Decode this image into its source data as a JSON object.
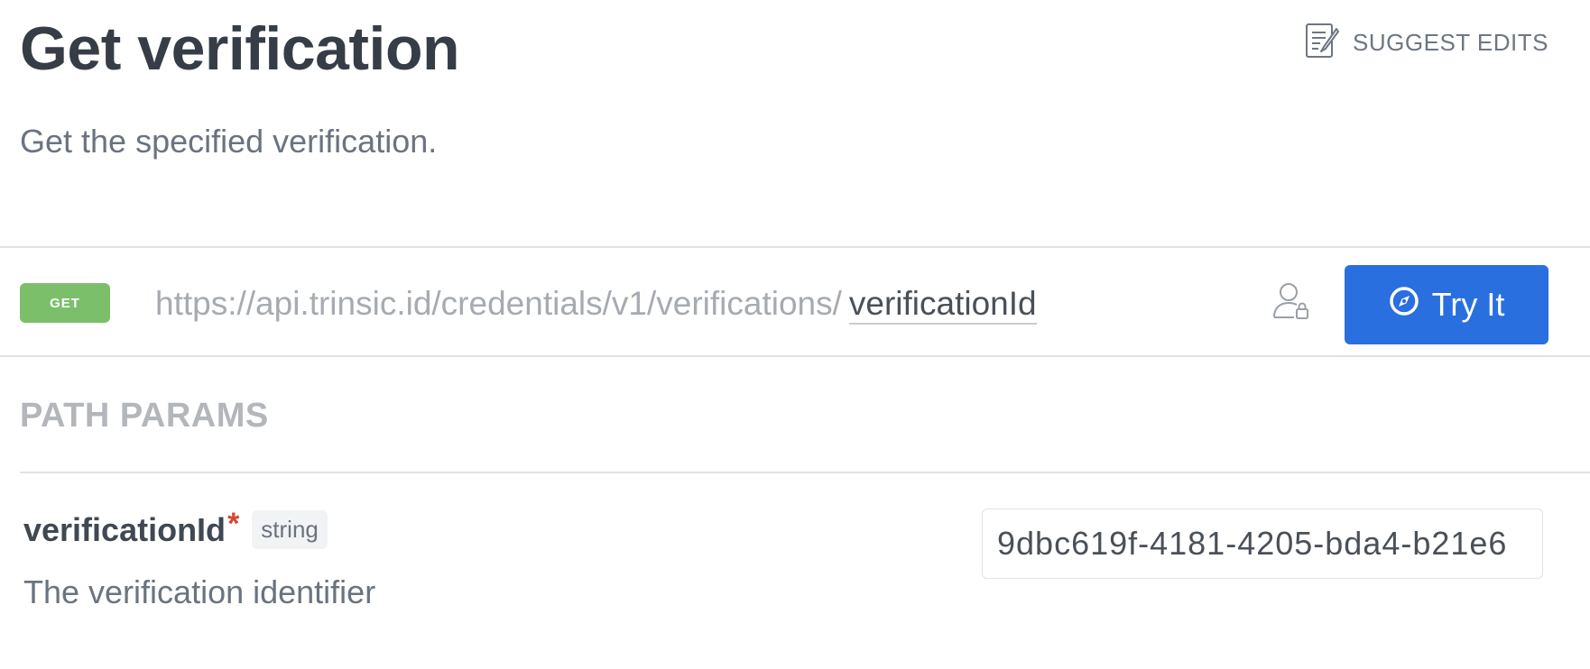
{
  "header": {
    "title": "Get verification",
    "subtitle": "Get the specified verification.",
    "suggest_edits_label": "SUGGEST EDITS",
    "suggest_edits_icon": "edit-document-icon"
  },
  "endpoint": {
    "method": "GET",
    "method_color": "#7cbf6b",
    "base_url": "https://api.trinsic.id/credentials/v1/verifications/",
    "path_param": "verificationId",
    "auth_icon": "user-lock-icon",
    "try_it_label": "Try It",
    "try_it_icon": "compass-icon",
    "try_it_color": "#2a6fdf"
  },
  "path_params": {
    "heading": "PATH PARAMS",
    "params": [
      {
        "name": "verificationId",
        "required_marker": "*",
        "type": "string",
        "description": "The verification identifier",
        "value": "9dbc619f-4181-4205-bda4-b21e6"
      }
    ]
  }
}
